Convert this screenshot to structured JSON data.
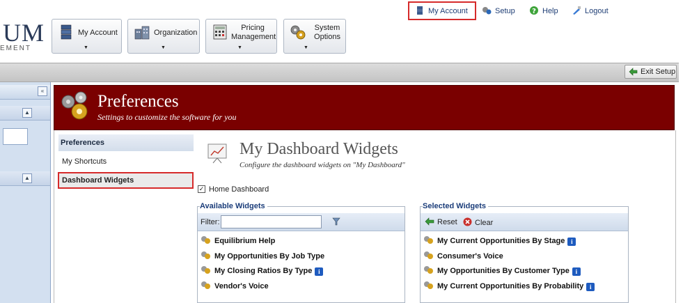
{
  "header": {
    "logo_text": "UM",
    "logo_sub": "EMENT",
    "nav": [
      {
        "label": "My Account",
        "icon": "server-stack-icon"
      },
      {
        "label": "Organization",
        "icon": "buildings-icon"
      },
      {
        "label": "Pricing Management",
        "label_line1": "Pricing",
        "label_line2": "Management",
        "icon": "calculator-icon"
      },
      {
        "label": "System Options",
        "label_line1": "System",
        "label_line2": "Options",
        "icon": "gears-icon"
      }
    ],
    "caret": "▼",
    "links": {
      "my_account": "My Account",
      "setup": "Setup",
      "help": "Help",
      "logout": "Logout"
    }
  },
  "toolbar": {
    "exit_setup": "Exit Setup"
  },
  "left_panel": {
    "collapse_glyph": "«",
    "up_glyph": "▲"
  },
  "banner": {
    "title": "Preferences",
    "subtitle": "Settings to customize the software for you"
  },
  "pref_nav": {
    "header": "Preferences",
    "items": [
      "My Shortcuts",
      "Dashboard Widgets"
    ]
  },
  "page": {
    "title": "My Dashboard Widgets",
    "subtitle": "Configure the dashboard widgets on \"My Dashboard\"",
    "checkbox_label": "Home Dashboard",
    "checkbox_checked": true,
    "check_glyph": "✓"
  },
  "available": {
    "legend": "Available Widgets",
    "filter_label": "Filter:",
    "filter_value": "",
    "items": [
      {
        "label": "Equilibrium Help",
        "info": false
      },
      {
        "label": "My Opportunities By Job Type",
        "info": false
      },
      {
        "label": "My Closing Ratios By Type",
        "info": true
      },
      {
        "label": "Vendor's Voice",
        "info": false
      }
    ]
  },
  "selected": {
    "legend": "Selected Widgets",
    "reset_label": "Reset",
    "clear_label": "Clear",
    "info_glyph": "i",
    "items": [
      {
        "label": "My Current Opportunities By Stage",
        "info": true
      },
      {
        "label": "Consumer's Voice",
        "info": false
      },
      {
        "label": "My Opportunities By Customer Type",
        "info": true
      },
      {
        "label": "My Current Opportunities By Probability",
        "info": true
      }
    ]
  },
  "colors": {
    "banner": "#7a0000",
    "highlight": "#d62a2a",
    "link": "#1f3e75",
    "legend": "#1b3d7a"
  }
}
